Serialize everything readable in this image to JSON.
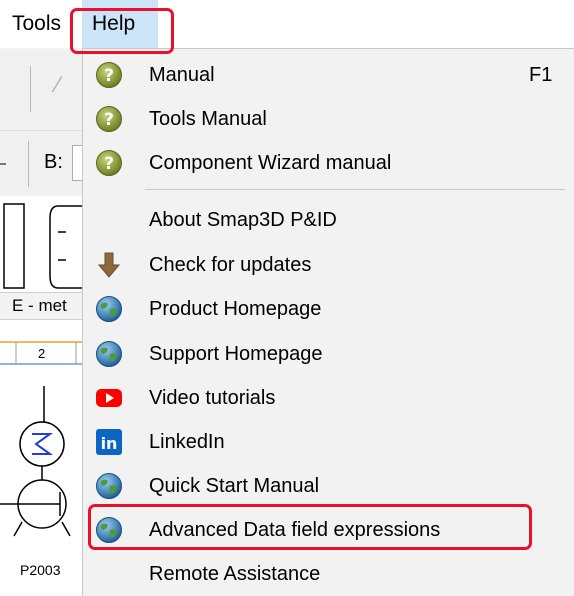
{
  "menubar": {
    "tools": "Tools",
    "help": "Help"
  },
  "background": {
    "combo_label": "B:",
    "tab_label": "E - met",
    "ruler_label": "2",
    "tag_label": "P2003"
  },
  "help_menu": {
    "items": [
      {
        "label": "Manual",
        "shortcut": "F1",
        "icon": "help-icon"
      },
      {
        "label": "Tools Manual",
        "icon": "help-icon"
      },
      {
        "label": "Component Wizard manual",
        "icon": "help-icon"
      },
      {
        "label": "About Smap3D P&ID",
        "icon": ""
      },
      {
        "label": "Check for updates",
        "icon": "download-arrow-icon"
      },
      {
        "label": "Product Homepage",
        "icon": "globe-icon"
      },
      {
        "label": "Support Homepage",
        "icon": "globe-icon"
      },
      {
        "label": "Video tutorials",
        "icon": "youtube-icon"
      },
      {
        "label": "LinkedIn",
        "icon": "linkedin-icon"
      },
      {
        "label": "Quick Start Manual",
        "icon": "globe-icon"
      },
      {
        "label": "Advanced Data field expressions",
        "icon": "globe-icon"
      },
      {
        "label": "Remote Assistance",
        "icon": ""
      }
    ]
  },
  "colors": {
    "highlight_outline": "#e8112d",
    "menu_background": "#f2f2f2",
    "help_selected": "#cce4f7"
  }
}
